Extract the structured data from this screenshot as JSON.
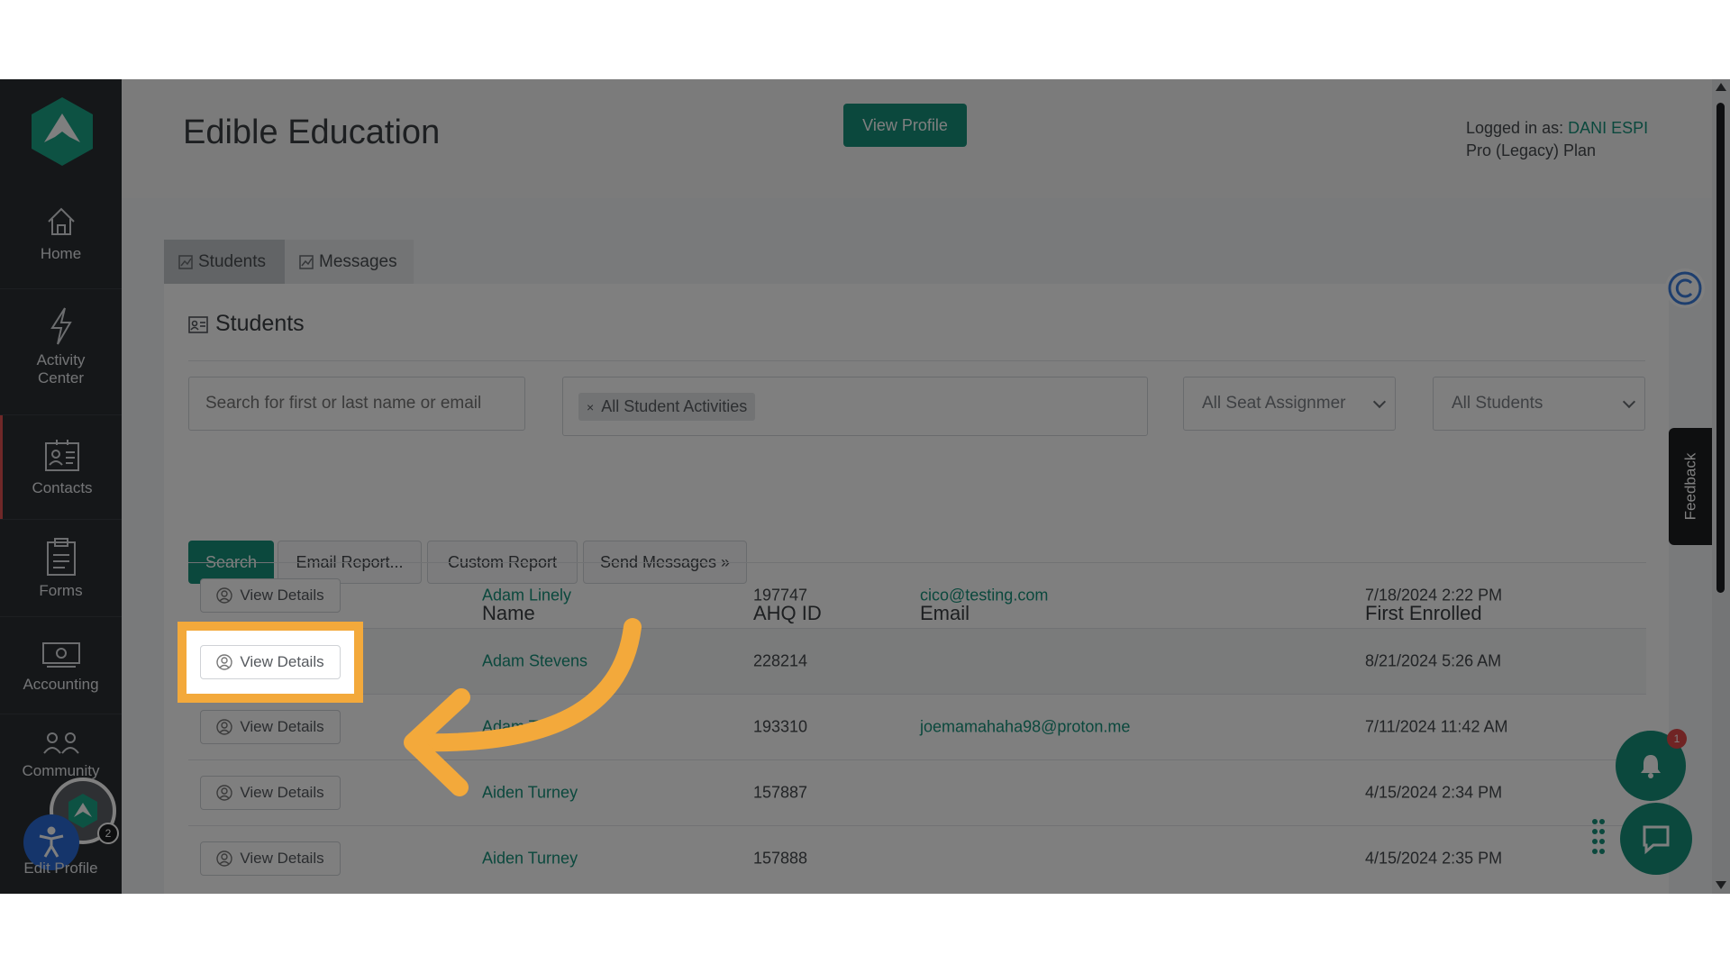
{
  "sidebar": {
    "items": [
      {
        "label": "Home",
        "icon": "home-icon"
      },
      {
        "label": "Activity\nCenter",
        "icon": "lightning-icon"
      },
      {
        "label": "Contacts",
        "icon": "contacts-icon"
      },
      {
        "label": "Forms",
        "icon": "clipboard-icon"
      },
      {
        "label": "Accounting",
        "icon": "cash-icon"
      },
      {
        "label": "Community",
        "icon": "community-icon"
      },
      {
        "label": "Edit Profile",
        "icon": "edit-profile-icon"
      }
    ],
    "profile_badge": "2"
  },
  "header": {
    "title": "Edible Education",
    "view_profile_label": "View Profile",
    "logged_in_prefix": "Logged in as: ",
    "logged_in_user": "DANI ESPI",
    "plan": "Pro (Legacy) Plan"
  },
  "tabs": [
    {
      "label": "Students",
      "icon": "chart-icon"
    },
    {
      "label": "Messages",
      "icon": "chart-icon"
    }
  ],
  "panel": {
    "title": "Students",
    "search_placeholder": "Search for first or last name or email",
    "activity_chip": "All Student Activities",
    "seat_select": "All Seat Assignmer",
    "students_select": "All Students",
    "buttons": {
      "search": "Search",
      "email_report": "Email Report...",
      "custom_report": "Custom Report",
      "send_messages": "Send Messages »"
    }
  },
  "table": {
    "headers": {
      "name": "Name",
      "id": "AHQ ID",
      "email": "Email",
      "enrolled": "First Enrolled"
    },
    "view_details_label": "View Details",
    "rows": [
      {
        "name": "Adam Linely",
        "id": "197747",
        "email": "cico@testing.com",
        "enrolled": "7/18/2024 2:22 PM"
      },
      {
        "name": "Adam Stevens",
        "id": "228214",
        "email": "",
        "enrolled": "8/21/2024 5:26 AM"
      },
      {
        "name": "Adam Test",
        "id": "193310",
        "email": "joemamahaha98@proton.me",
        "enrolled": "7/11/2024 11:42 AM"
      },
      {
        "name": "Aiden Turney",
        "id": "157887",
        "email": "",
        "enrolled": "4/15/2024 2:34 PM"
      },
      {
        "name": "Aiden Turney",
        "id": "157888",
        "email": "",
        "enrolled": "4/15/2024 2:35 PM"
      }
    ]
  },
  "widgets": {
    "feedback_label": "Feedback",
    "notification_count": "1"
  },
  "colors": {
    "accent": "#16917a",
    "highlight": "#f3a93b",
    "sidebar": "#2b2f33"
  }
}
